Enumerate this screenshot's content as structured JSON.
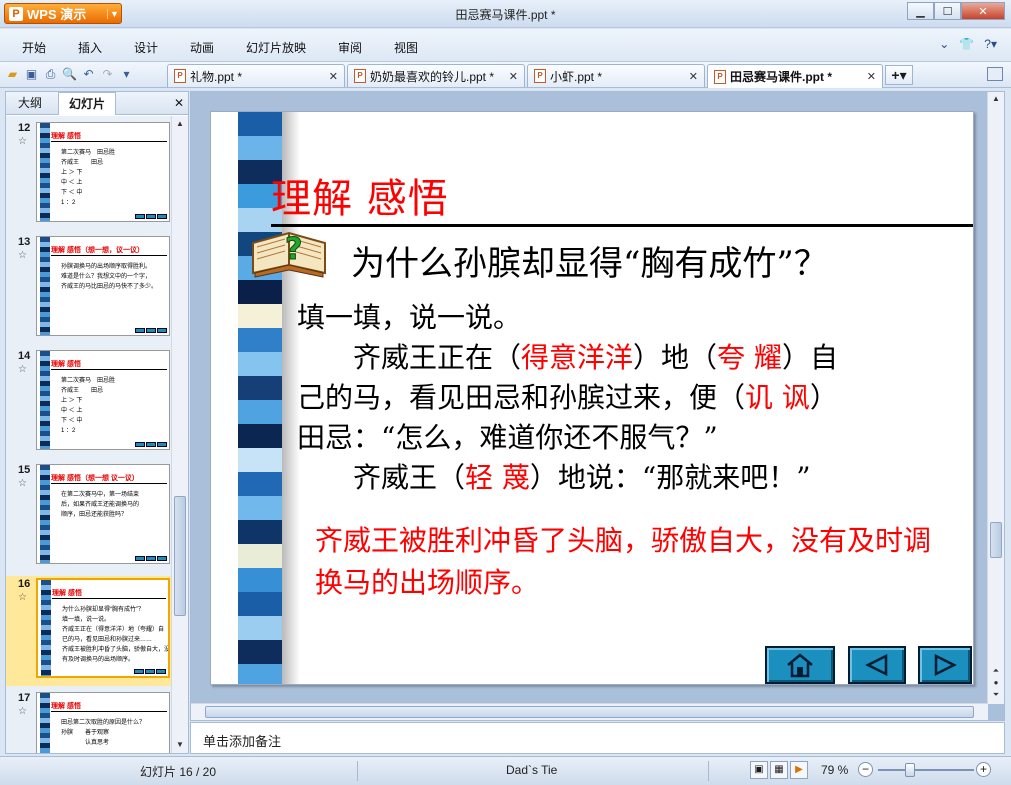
{
  "app": {
    "brand_label": "WPS 演示",
    "window_title": "田忌赛马课件.ppt *"
  },
  "menu": [
    "开始",
    "插入",
    "设计",
    "动画",
    "幻灯片放映",
    "审阅",
    "视图"
  ],
  "doc_tabs": [
    {
      "label": "礼物.ppt *"
    },
    {
      "label": "奶奶最喜欢的铃儿.ppt *"
    },
    {
      "label": "小虾.ppt *"
    },
    {
      "label": "田忌赛马课件.ppt *",
      "active": true
    }
  ],
  "left_panel": {
    "tabs": [
      "大纲",
      "幻灯片"
    ],
    "active_tab": "幻灯片"
  },
  "thumbnails": [
    {
      "num": "12",
      "title": "理解  感悟",
      "lines": [
        "第二次赛马　田忌胜",
        "齐威王　　田忌",
        "上 ＞ 下",
        "中 ＜ 上",
        "下 ＜ 中",
        "1 ：2"
      ]
    },
    {
      "num": "13",
      "title": "理解 感悟（想一想，议一议）",
      "lines": [
        "孙膑调换马的出场顺序取得胜利。",
        "难道是什么？我想文中的一个字，",
        "齐威王的马比田忌的马快不了多少。"
      ]
    },
    {
      "num": "14",
      "title": "理解 感悟",
      "lines": [
        "第二次赛马　田忌胜",
        "齐威王　　田忌",
        "上 ＞ 下",
        "中 ＜ 上",
        "下 ＜ 中",
        "1 ：2"
      ]
    },
    {
      "num": "15",
      "title": "理解 感悟（想一想 议一议）",
      "lines": [
        "在第二次赛马中，第一场结束",
        "后，如果齐威王还能调换马的",
        "顺序，田忌还能获胜吗？"
      ]
    },
    {
      "num": "16",
      "title": "理解 感悟",
      "lines": [
        "为什么孙膑却显得“胸有成竹”？",
        "填一填，说一说。",
        "齐威王正在（得意洋洋）地（夸耀）自",
        "已的马，看见田忌和孙膑过来……",
        "齐威王被胜利冲昏了头脑，骄傲自大，没",
        "有及时调换马的出场顺序。"
      ],
      "selected": true
    },
    {
      "num": "17",
      "title": "理解 感悟",
      "lines": [
        "田忌第二次取胜的原因是什么？",
        "孙膑　　善于观察",
        "　　　　认真思考"
      ]
    }
  ],
  "slide": {
    "title": "理解  感悟",
    "question": "为什么孙膑却显得“胸有成竹”？",
    "intro": "填一填，说一说。",
    "p1_a": "齐威王正在（",
    "p1_ans1": "得意洋洋",
    "p1_b": "）地（",
    "p1_ans2": "夸 耀",
    "p1_c": "）自",
    "p2_a": "己的马，看见田忌和孙膑过来，便（",
    "p2_ans": "讥 讽",
    "p2_b": "）",
    "p3": "田忌：“怎么，难道你还不服气？”",
    "p4_a": "齐威王（",
    "p4_ans": "轻 蔑",
    "p4_b": "）地说：“那就来吧！”",
    "conclusion": "齐威王被胜利冲昏了头脑，骄傲自大，没有及时调换马的出场顺序。",
    "accent_color": "#ff0000",
    "nav_color": "#1b8fbd"
  },
  "notes": {
    "placeholder": "单击添加备注"
  },
  "status": {
    "slide_indicator": "幻灯片 16 / 20",
    "theme": "Dad`s Tie",
    "zoom": "79 %"
  }
}
